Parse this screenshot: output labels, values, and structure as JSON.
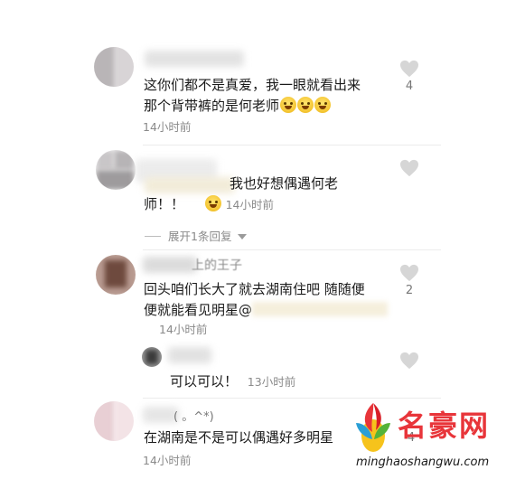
{
  "comments": [
    {
      "text_line1": "这你们都不是真爱，我一眼就看出来",
      "text_line2": "那个背带裤的是何老师",
      "time": "14小时前",
      "likes": "4"
    },
    {
      "text_line1": "我也好想偶遇何老",
      "text_line2": "师！！",
      "time": "14小时前",
      "expand": "展开1条回复"
    },
    {
      "name_fragment": "上的王子",
      "text_line1": "回头咱们长大了就去湖南住吧 随随便",
      "text_line2": "便就能看见明星@",
      "time": "14小时前",
      "likes": "2",
      "reply": {
        "text": "可以可以！",
        "time": "13小时前"
      }
    },
    {
      "name_fragment": "( 。^*)",
      "text_line1": "在湖南是不是可以偶遇好多明星",
      "time": "14小时前",
      "likes": "4"
    }
  ],
  "watermark": {
    "brand": "名豪网",
    "url": "minghaoshangwu.com"
  },
  "colors": {
    "heart": "#d6d6d6",
    "time": "#8a8a8a",
    "brand": "#e8353a"
  }
}
